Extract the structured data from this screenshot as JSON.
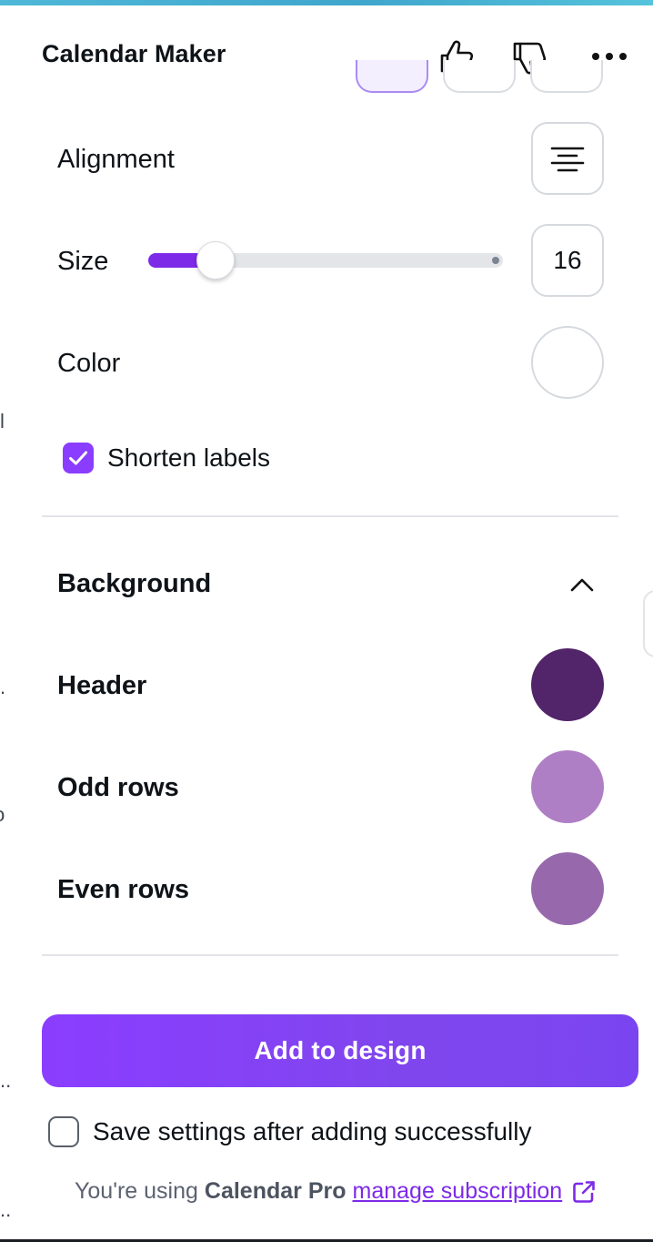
{
  "header": {
    "title": "Calendar Maker"
  },
  "text_settings": {
    "alignment_label": "Alignment",
    "size_label": "Size",
    "size_value": "16",
    "size_slider_fraction": 0.19,
    "color_label": "Color",
    "color_value": "#ffffff",
    "shorten_labels_label": "Shorten labels",
    "shorten_labels_checked": true
  },
  "background": {
    "section_title": "Background",
    "rows": [
      {
        "label": "Header",
        "color": "#52246a"
      },
      {
        "label": "Odd rows",
        "color": "#af7fc5"
      },
      {
        "label": "Even rows",
        "color": "#9769ac"
      }
    ]
  },
  "actions": {
    "add_to_design_label": "Add to design",
    "save_settings_label": "Save settings after adding successfully",
    "save_settings_checked": false
  },
  "footer": {
    "prefix": "You're using",
    "plan_name": "Calendar Pro",
    "link_label": "manage subscription"
  },
  "colors": {
    "accent": "#8b3dff",
    "text": "#0e1318",
    "muted": "#5b6270"
  },
  "left_edge_fragments": [
    "l",
    ".",
    "o",
    "..",
    ".."
  ]
}
